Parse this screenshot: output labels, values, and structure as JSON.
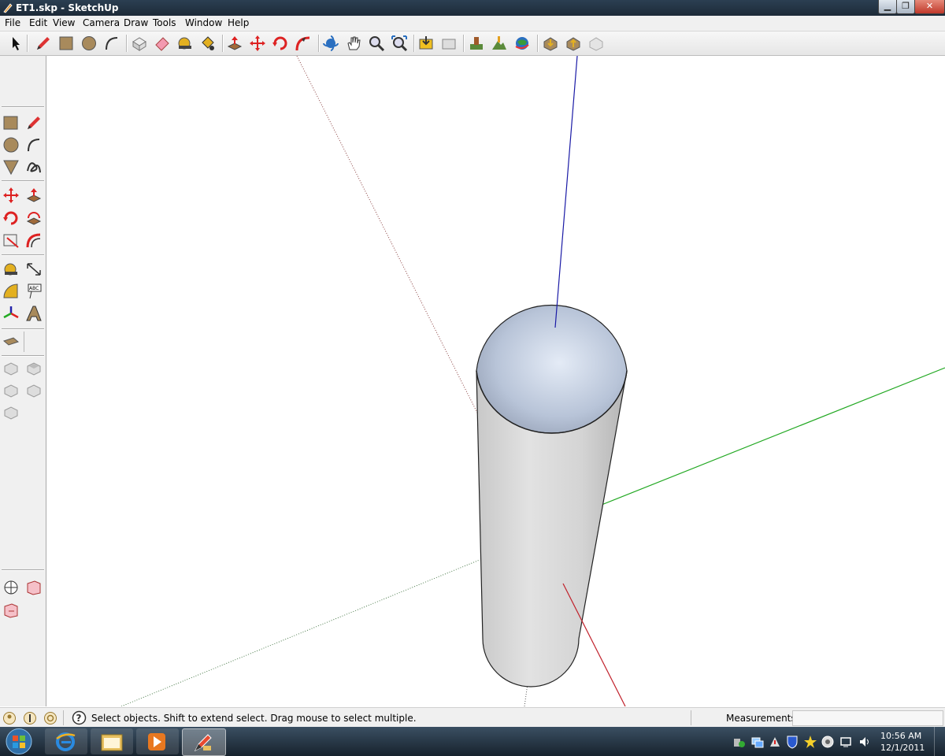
{
  "window": {
    "title": "ET1.skp - SketchUp"
  },
  "menu": [
    "File",
    "Edit",
    "View",
    "Camera",
    "Draw",
    "Tools",
    "Window",
    "Help"
  ],
  "status": {
    "hint": "Select objects. Shift to extend select. Drag mouse to select multiple.",
    "measurements_label": "Measurements",
    "measurements_value": ""
  },
  "taskbar": {
    "time": "10:56 AM",
    "date": "12/1/2011"
  },
  "toolbar_top": [
    "select",
    "pencil",
    "rectangle",
    "circle",
    "arc",
    "make-component",
    "eraser",
    "tape-measure",
    "paint-bucket",
    "push-pull",
    "move",
    "rotate",
    "follow-me",
    "orbit",
    "pan",
    "zoom",
    "zoom-extents",
    "get-models",
    "share-model",
    "add-location",
    "toggle-terrain",
    "preview-google-earth",
    "get-photo-texture",
    "share-component",
    "3d-warehouse"
  ],
  "toolbar_left": [
    "rectangle",
    "line",
    "circle",
    "arc",
    "polygon",
    "freehand",
    "move",
    "push-pull",
    "rotate",
    "follow-me",
    "scale",
    "offset",
    "tape-measure",
    "dimension",
    "protractor",
    "text",
    "axes",
    "3d-text",
    "section-plane",
    "section-display",
    "iso-view",
    "top-view",
    "front-view",
    "right-view",
    "back-view",
    "left-view",
    "position-camera",
    "walk",
    "look-around"
  ],
  "colors": {
    "axis_blue": "#1a1aa6",
    "axis_green": "#22a822",
    "axis_red": "#c0202a",
    "model_face": "#d8d8d8",
    "sphere_face": "#b8c4d8"
  }
}
